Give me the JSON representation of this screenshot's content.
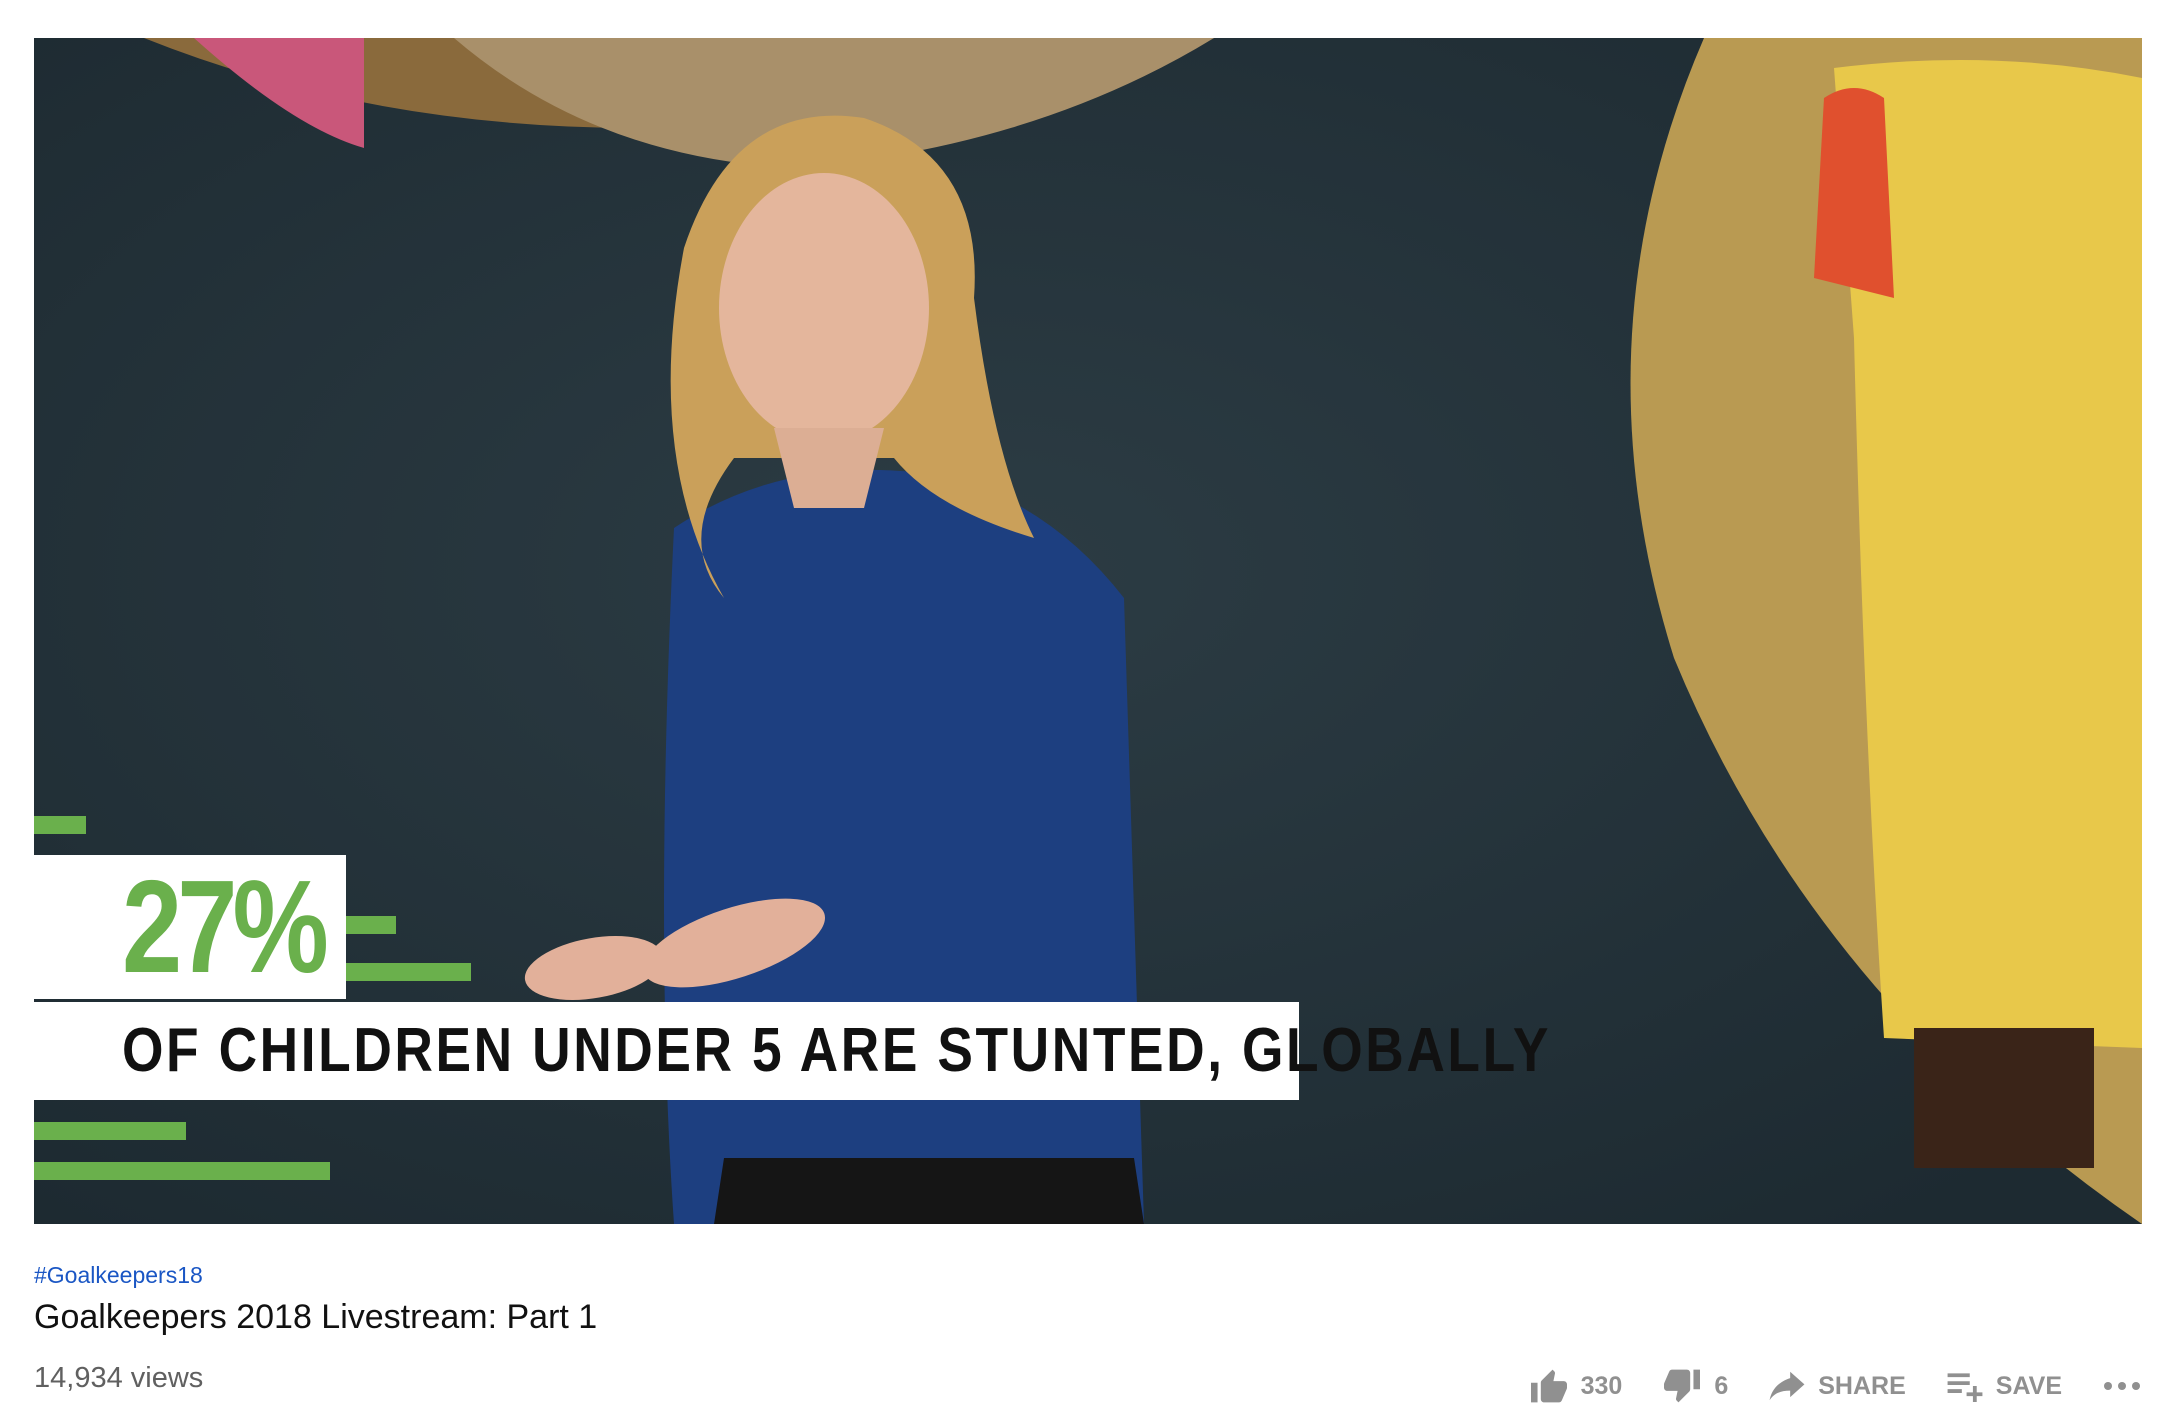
{
  "video": {
    "overlay_stat": "27%",
    "overlay_caption": "OF CHILDREN UNDER 5 ARE STUNTED, GLOBALLY"
  },
  "info": {
    "hashtag": "#Goalkeepers18",
    "title": "Goalkeepers 2018 Livestream: Part 1",
    "views": "14,934 views"
  },
  "actions": {
    "like_count": "330",
    "dislike_count": "6",
    "share_label": "SHARE",
    "save_label": "SAVE"
  },
  "colors": {
    "accent_green": "#6ab04c",
    "hashtag_blue": "#1a56c4",
    "action_gray": "#909090"
  },
  "icons": [
    "thumb-up-icon",
    "thumb-down-icon",
    "share-arrow-icon",
    "playlist-add-icon",
    "more-horizontal-icon"
  ]
}
